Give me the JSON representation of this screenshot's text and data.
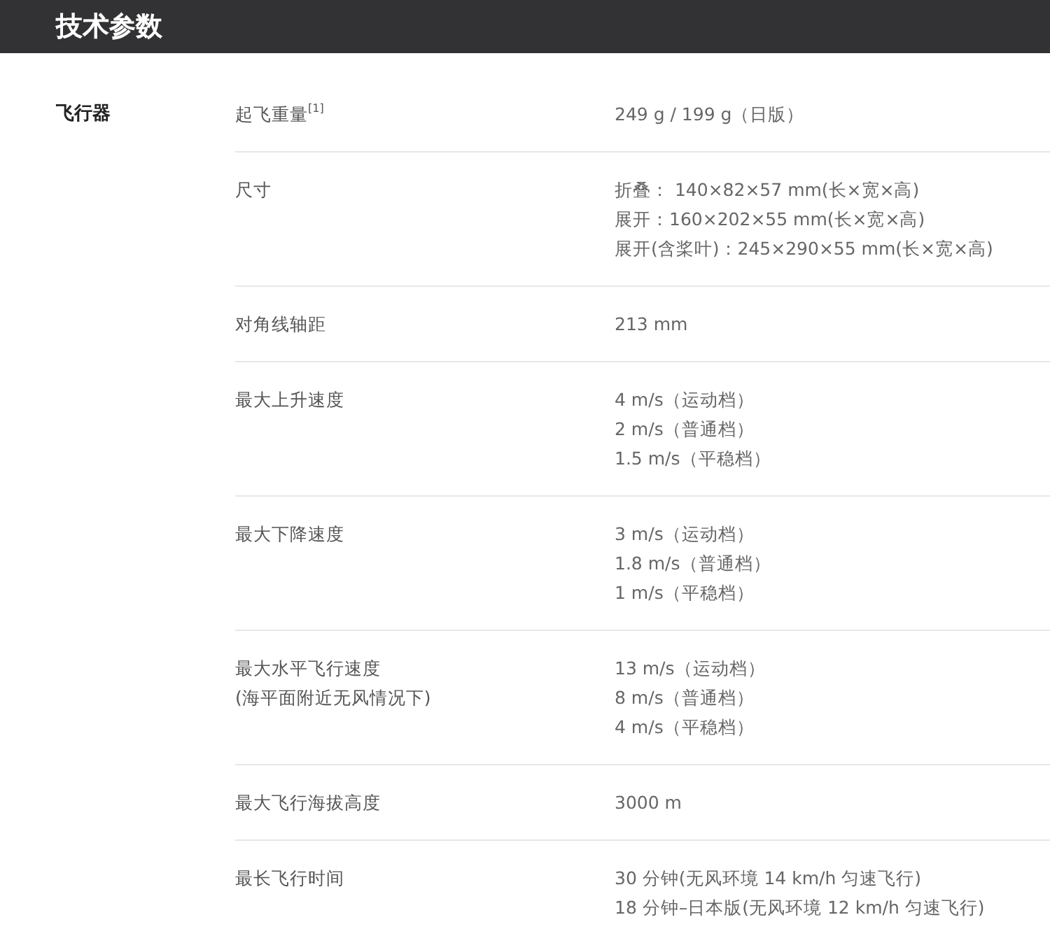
{
  "header": {
    "title": "技术参数"
  },
  "sections": [
    {
      "title": "飞行器",
      "rows": [
        {
          "label": [
            "起飞重量$^{[1]}$"
          ],
          "values": [
            "249 g / 199 g（日版）"
          ]
        },
        {
          "label": [
            "尺寸"
          ],
          "values": [
            "折叠： 140×82×57 mm(长×宽×高)",
            "展开：160×202×55 mm(长×宽×高)",
            "展开(含桨叶)：245×290×55 mm(长×宽×高)"
          ]
        },
        {
          "label": [
            "对角线轴距"
          ],
          "values": [
            "213 mm"
          ]
        },
        {
          "label": [
            "最大上升速度"
          ],
          "values": [
            "4 m/s（运动档）",
            "2 m/s（普通档）",
            "1.5 m/s（平稳档）"
          ]
        },
        {
          "label": [
            "最大下降速度"
          ],
          "values": [
            "3 m/s（运动档）",
            "1.8 m/s（普通档）",
            "1 m/s（平稳档）"
          ]
        },
        {
          "label": [
            "最大水平飞行速度",
            "(海平面附近无风情况下)"
          ],
          "values": [
            "13 m/s（运动档）",
            "8 m/s（普通档）",
            "4 m/s（平稳档）"
          ]
        },
        {
          "label": [
            "最大飞行海拔高度"
          ],
          "values": [
            "3000 m"
          ]
        },
        {
          "label": [
            "最长飞行时间"
          ],
          "values": [
            "30 分钟(无风环境 14 km/h 匀速飞行)",
            "18 分钟–日本版(无风环境 12 km/h 匀速飞行)"
          ]
        }
      ]
    }
  ]
}
